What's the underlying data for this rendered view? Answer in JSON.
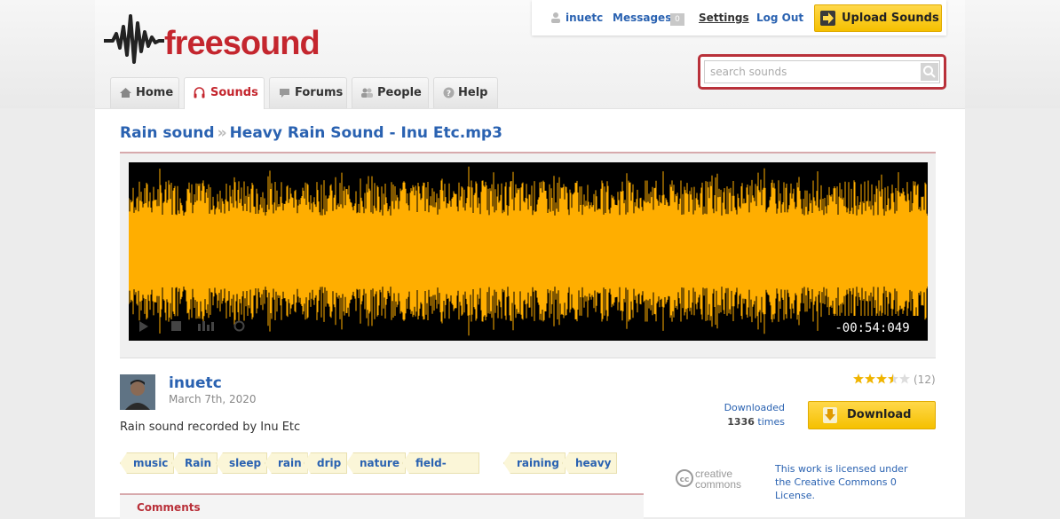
{
  "brand": {
    "name": "freesound",
    "accent": "#c4262e",
    "link_color": "#2a62b1"
  },
  "userbar": {
    "username": "inuetc",
    "messages_label": "Messages",
    "messages_count": "0",
    "settings_label": "Settings",
    "logout_label": "Log Out",
    "upload_label": "Upload Sounds"
  },
  "search": {
    "placeholder": "search sounds"
  },
  "nav": {
    "tabs": [
      {
        "label": "Home",
        "icon": "home-icon"
      },
      {
        "label": "Sounds",
        "icon": "headphones-icon",
        "active": true
      },
      {
        "label": "Forums",
        "icon": "speech-bubble-icon"
      },
      {
        "label": "People",
        "icon": "people-icon"
      },
      {
        "label": "Help",
        "icon": "question-icon"
      }
    ]
  },
  "breadcrumb": {
    "parent": "Rain sound",
    "separator": "»",
    "current": "Heavy Rain Sound - Inu Etc.mp3"
  },
  "player": {
    "time_remaining": "-00:54:049",
    "waveform_color": "#ffae00"
  },
  "sound": {
    "author": "inuetc",
    "date": "March 7th, 2020",
    "description": "Rain sound recorded by Inu Etc",
    "tags": [
      "music",
      "Rain",
      "sleep",
      "rain",
      "drip",
      "nature",
      "field-recording",
      "raining",
      "heavy"
    ]
  },
  "rating": {
    "stars": 3.5,
    "count": "(12)"
  },
  "downloads": {
    "label": "Downloaded",
    "count": "1336",
    "suffix": "times",
    "button_label": "Download"
  },
  "license": {
    "logo_line1": "creative",
    "logo_line2": "commons",
    "text": "This work is licensed under the Creative Commons 0 License."
  },
  "comments": {
    "label": "Comments"
  }
}
